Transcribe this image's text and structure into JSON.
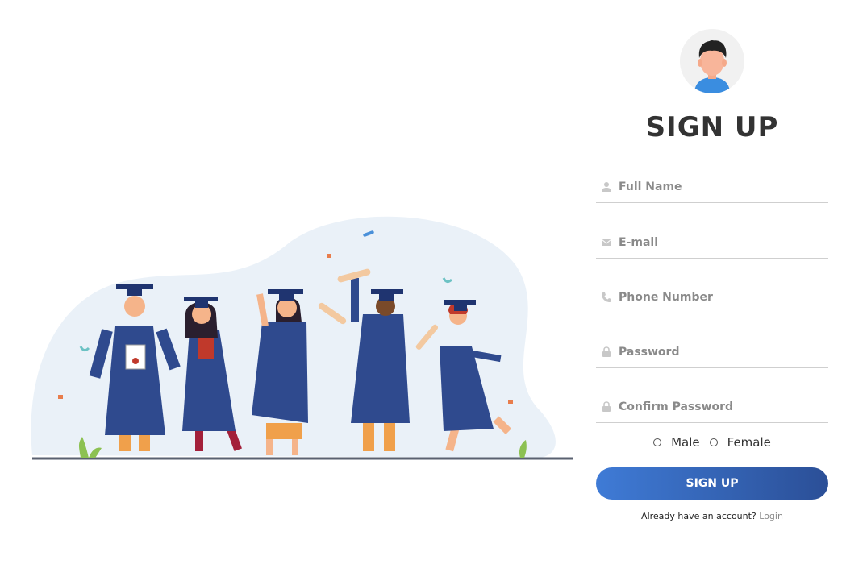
{
  "signup": {
    "title": "SIGN UP",
    "fields": [
      {
        "placeholder": "Full Name",
        "icon": "user-icon"
      },
      {
        "placeholder": "E-mail",
        "icon": "envelope-icon"
      },
      {
        "placeholder": "Phone Number",
        "icon": "phone-icon"
      },
      {
        "placeholder": "Password",
        "icon": "lock-icon"
      },
      {
        "placeholder": "Confirm Password",
        "icon": "lock-icon"
      }
    ],
    "gender": {
      "male": "Male",
      "female": "Female"
    },
    "button_label": "SIGN UP",
    "footer": {
      "prompt": "Already have an account?",
      "link": "Login"
    }
  },
  "colors": {
    "button_gradient_start": "#3f7bd6",
    "button_gradient_end": "#2b4f97",
    "gown": "#2f4a8e",
    "blob": "#eaf1f8"
  }
}
